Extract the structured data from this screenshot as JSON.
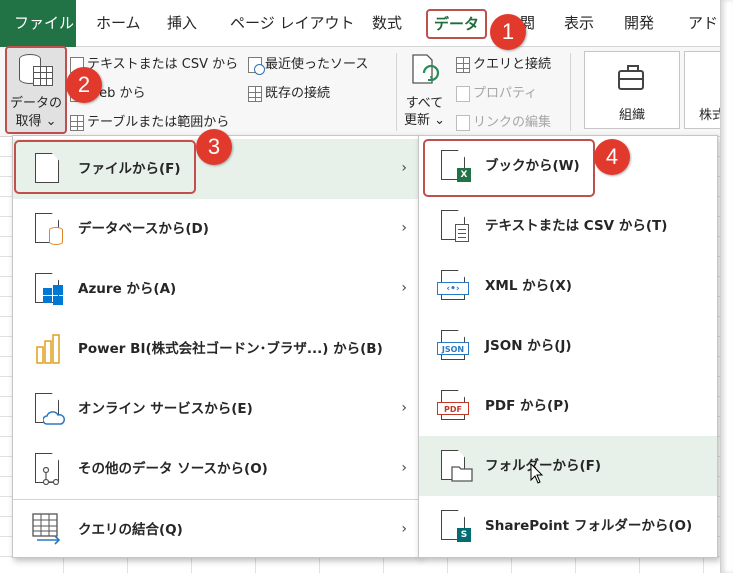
{
  "tabs": [
    {
      "id": "file",
      "label": "ファイル"
    },
    {
      "id": "home",
      "label": "ホーム"
    },
    {
      "id": "insert",
      "label": "挿入"
    },
    {
      "id": "pagelayout",
      "label": "ページ レイアウト"
    },
    {
      "id": "formulas",
      "label": "数式"
    },
    {
      "id": "data",
      "label": "データ"
    },
    {
      "id": "review",
      "label": "閲"
    },
    {
      "id": "view",
      "label": "表示"
    },
    {
      "id": "developer",
      "label": "開発"
    },
    {
      "id": "addin",
      "label": "アド"
    }
  ],
  "ribbon": {
    "get_data_line1": "データの",
    "get_data_line2": "取得 ⌄",
    "from_text_csv": "テキストまたは CSV から",
    "from_web": "Web から",
    "from_table": "テーブルまたは範囲から",
    "recent_sources": "最近使ったソース",
    "existing_connections": "既存の接続",
    "refresh_all_line1": "すべて",
    "refresh_all_line2": "更新 ⌄",
    "queries_connections": "クエリと接続",
    "properties": "プロパティ",
    "edit_links": "リンクの編集",
    "organization": "組織",
    "stocks": "株式"
  },
  "menu1": [
    {
      "label": "ファイルから(F)",
      "icon": "file-icon",
      "arrow": true
    },
    {
      "label": "データベースから(D)",
      "icon": "database-icon",
      "arrow": true
    },
    {
      "label": "Azure から(A)",
      "icon": "azure-icon",
      "arrow": true
    },
    {
      "label": "Power BI(株式会社ゴードン･ブラザ...) から(B)",
      "icon": "powerbi-icon",
      "arrow": false
    },
    {
      "label": "オンライン サービスから(E)",
      "icon": "cloud-icon",
      "arrow": true
    },
    {
      "label": "その他のデータ ソースから(O)",
      "icon": "other-sources-icon",
      "arrow": true
    },
    {
      "label": "クエリの結合(Q)",
      "icon": "combine-queries-icon",
      "arrow": true
    }
  ],
  "menu2": [
    {
      "label": "ブックから(W)",
      "icon": "excel-workbook-icon",
      "badge": "X"
    },
    {
      "label": "テキストまたは CSV から(T)",
      "icon": "text-file-icon"
    },
    {
      "label": "XML から(X)",
      "icon": "xml-icon",
      "badge": "‹•›"
    },
    {
      "label": "JSON から(J)",
      "icon": "json-icon",
      "badge": "JSON"
    },
    {
      "label": "PDF から(P)",
      "icon": "pdf-icon",
      "badge": "PDF"
    },
    {
      "label": "フォルダーから(F)",
      "icon": "folder-icon"
    },
    {
      "label": "SharePoint フォルダーから(O)",
      "icon": "sharepoint-icon",
      "badge": "S"
    }
  ],
  "callouts": [
    "1",
    "2",
    "3",
    "4"
  ],
  "colors": {
    "excel_green": "#217346",
    "callout_red": "#e13a2d",
    "box_red": "#c0504d",
    "highlight": "#e8f0ea"
  }
}
